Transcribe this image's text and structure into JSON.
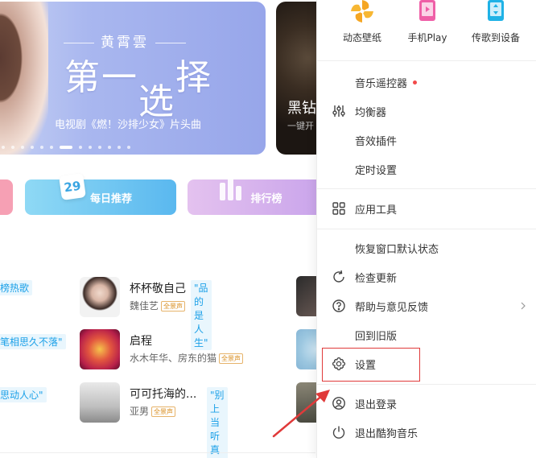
{
  "banner": {
    "artist": "黄霄雲",
    "song_part1": "第一",
    "song_part2": "选",
    "song_part3": "择",
    "caption": "电视剧《燃！沙排少女》片头曲"
  },
  "banner2": {
    "title": "黑钻",
    "subtitle": "一键开"
  },
  "shortcuts": {
    "daily_label": "每日推荐",
    "daily_date": "29",
    "rank_label": "排行榜"
  },
  "left_tags": [
    "榜热歌",
    "笔相思久不落\"",
    "思动人心\""
  ],
  "tracks": [
    {
      "title": "杯杯敬自己",
      "tag": "\"品的是人生\"",
      "artist": "魏佳艺",
      "badge": "全景声"
    },
    {
      "title": "启程",
      "tag": "",
      "artist": "水木年华、房东的猫",
      "badge": "全景声"
    },
    {
      "title": "可可托海的...",
      "tag": "\"别上当听真声\"",
      "artist": "亚男",
      "badge": "全景声"
    }
  ],
  "menu": {
    "top": [
      {
        "label": "动态壁纸",
        "icon": "pinwheel-icon"
      },
      {
        "label": "手机Play",
        "icon": "phone-play-icon"
      },
      {
        "label": "传歌到设备",
        "icon": "phone-transfer-icon"
      }
    ],
    "group1": [
      {
        "label": "音乐遥控器",
        "icon": "",
        "red_dot": true
      },
      {
        "label": "均衡器",
        "icon": "equalizer-icon"
      },
      {
        "label": "音效插件",
        "icon": ""
      },
      {
        "label": "定时设置",
        "icon": ""
      }
    ],
    "group2": [
      {
        "label": "应用工具",
        "icon": "grid-apps-icon"
      }
    ],
    "group3": [
      {
        "label": "恢复窗口默认状态",
        "icon": ""
      },
      {
        "label": "检查更新",
        "icon": "refresh-icon"
      },
      {
        "label": "帮助与意见反馈",
        "icon": "help-icon",
        "has_submenu": true
      },
      {
        "label": "回到旧版",
        "icon": ""
      },
      {
        "label": "设置",
        "icon": "gear-icon"
      }
    ],
    "group4": [
      {
        "label": "退出登录",
        "icon": "user-logout-icon"
      },
      {
        "label": "退出酷狗音乐",
        "icon": "power-icon"
      }
    ]
  },
  "colors": {
    "accent_blue": "#1aa0e8",
    "highlight_red": "#e03a3a",
    "badge_orange": "#d98e1f"
  }
}
